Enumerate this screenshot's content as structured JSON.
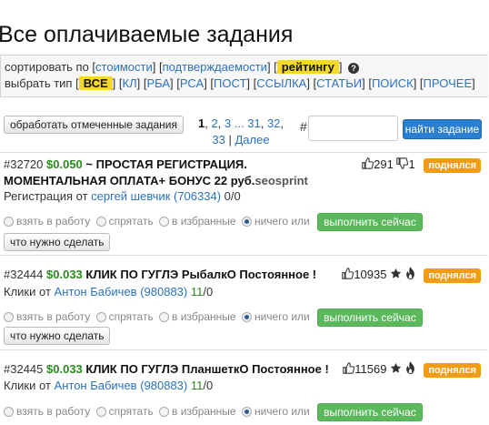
{
  "page_title": "Все оплачиваемые задания",
  "filters": {
    "sort_prefix": "сортировать по",
    "sort_options": [
      "стоимости",
      "подтверждаемости",
      "рейтингу"
    ],
    "sort_active_index": 2,
    "type_prefix": "выбрать тип",
    "type_options": [
      "ВСЕ",
      "КЛ",
      "РБА",
      "РСА",
      "ПОСТ",
      "ССЫЛКА",
      "СТАТЬИ",
      "ПОИСК",
      "ПРОЧЕЕ"
    ],
    "type_active_index": 0
  },
  "actions": {
    "process_selected_label": "обработать отмеченные задания",
    "pager": {
      "current": "1",
      "pages": [
        "2",
        "3",
        "...",
        "31",
        "32",
        "33"
      ],
      "next_label": "Далее"
    },
    "hash_label": "#",
    "task_input_value": "",
    "find_task_label": "найти задание"
  },
  "option_labels": {
    "take": "взять в работу",
    "hide": "спрятать",
    "favorite": "в избранные",
    "nothing_or": "ничего или",
    "do_now": "выполнить сейчас",
    "what_to_do": "что нужно сделать"
  },
  "tasks": [
    {
      "id": "#32720",
      "price": "$0.050",
      "title": "~ ПРОСТАЯ РЕГИСТРАЦИЯ. МОМЕНТАЛЬНАЯ ОПЛАТА+ БОНУС 22 руб.",
      "title_suffix": "seosprint",
      "likes": "291",
      "dislikes": "1",
      "badge": "поднялся",
      "category": "Регистрация",
      "from_label": "от",
      "author": "сергей шевчик (706334)",
      "count_done": "0",
      "count_total": "0",
      "selected_option": "nothing",
      "star_icon": false,
      "fire_icon": false
    },
    {
      "id": "#32444",
      "price": "$0.033",
      "title": "КЛИК ПО ГУГЛЭ РыбалкО Постоянное !",
      "title_suffix": "",
      "likes": "10935",
      "dislikes": "",
      "badge": "поднялся",
      "category": "Клики",
      "from_label": "от",
      "author": "Антон Бабичев (980883)",
      "count_done": "11",
      "count_total": "0",
      "selected_option": "nothing",
      "star_icon": true,
      "fire_icon": true
    },
    {
      "id": "#32445",
      "price": "$0.033",
      "title": "КЛИК ПО ГУГЛЭ ПланшеткО Постоянное !",
      "title_suffix": "",
      "likes": "11569",
      "dislikes": "",
      "badge": "поднялся",
      "category": "Клики",
      "from_label": "от",
      "author": "Антон Бабичев (980883)",
      "count_done": "11",
      "count_total": "0",
      "selected_option": "nothing",
      "star_icon": true,
      "fire_icon": true
    }
  ],
  "colors": {
    "link": "#2b72c1",
    "price_green": "#2a8a1c",
    "highlight_yellow": "#f4d82a",
    "badge_orange": "#f39c12",
    "button_blue": "#2a7fd0",
    "button_green": "#5cb85c"
  },
  "icons": [
    "help-icon",
    "thumbs-up-icon",
    "thumbs-down-icon",
    "star-icon",
    "fire-icon",
    "radio-icon"
  ]
}
